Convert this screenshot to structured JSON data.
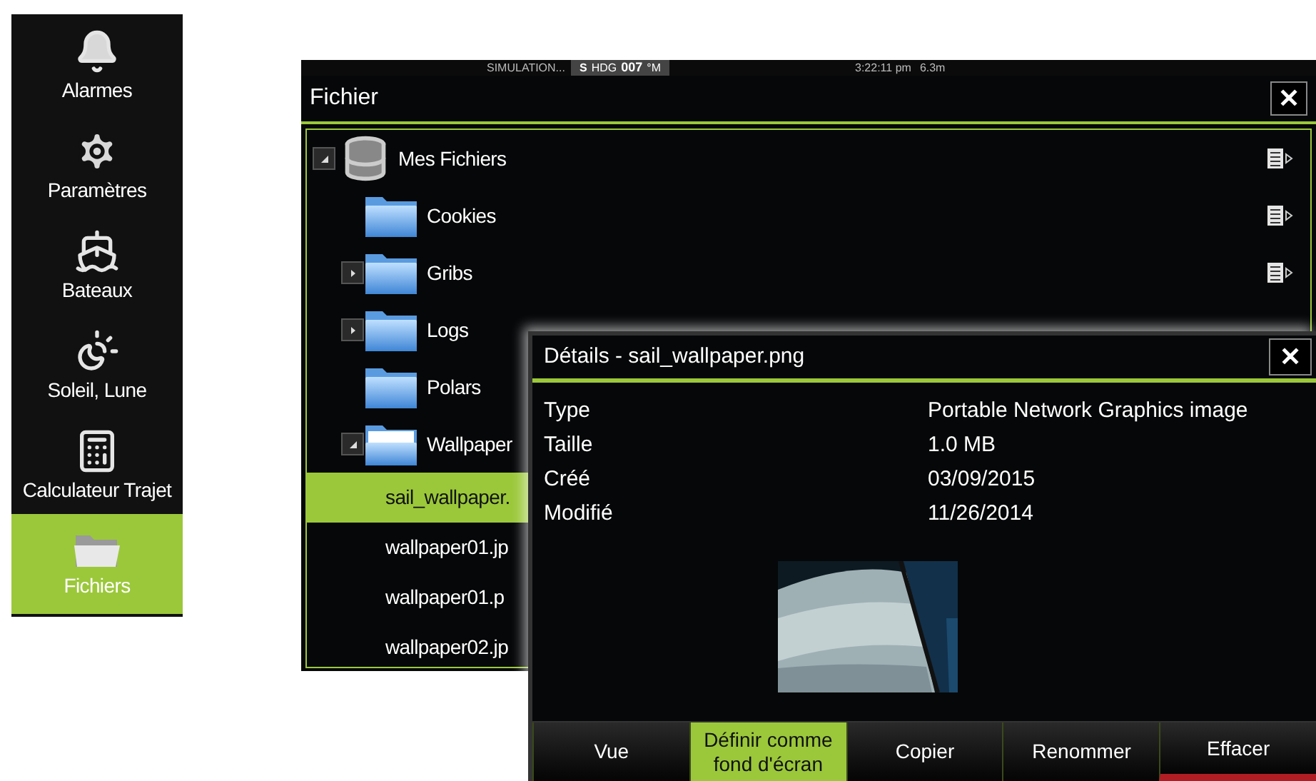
{
  "sidebar": {
    "items": [
      {
        "kind": "alarm",
        "label": "Alarmes",
        "selected": false
      },
      {
        "kind": "settings",
        "label": "Paramètres",
        "selected": false
      },
      {
        "kind": "boats",
        "label": "Bateaux",
        "selected": false
      },
      {
        "kind": "sun-moon",
        "label": "Soleil, Lune",
        "selected": false
      },
      {
        "kind": "calculator",
        "label": "Calculateur Trajet",
        "selected": false
      },
      {
        "kind": "files",
        "label": "Fichiers",
        "selected": true
      }
    ]
  },
  "status_bar": {
    "mode": "SIMULATION...",
    "heading_source": "S",
    "heading_label": "HDG",
    "heading_value": "007",
    "heading_unit": "°M",
    "time": "3:22:11 pm",
    "depth": "6.3m"
  },
  "file_window": {
    "title": "Fichier",
    "close": "✕",
    "tree": [
      {
        "kind": "drive",
        "label": "Mes Fichiers",
        "expanded": true,
        "selected": false,
        "menu": true,
        "children": [
          {
            "kind": "folder",
            "label": "Cookies",
            "selected": false,
            "menu": true
          },
          {
            "kind": "folder",
            "label": "Gribs",
            "expanded": false,
            "selected": false,
            "menu": true
          },
          {
            "kind": "folder",
            "label": "Logs",
            "expanded": false,
            "selected": false
          },
          {
            "kind": "folder",
            "label": "Polars",
            "selected": false
          },
          {
            "kind": "folder-open",
            "label": "Wallpaper",
            "expanded": true,
            "selected": false,
            "children": [
              {
                "kind": "file",
                "label": "sail_wallpaper.",
                "selected": true
              },
              {
                "kind": "file",
                "label": "wallpaper01.jp",
                "selected": false
              },
              {
                "kind": "file",
                "label": "wallpaper01.p",
                "selected": false
              },
              {
                "kind": "file",
                "label": "wallpaper02.jp",
                "selected": false
              }
            ]
          }
        ]
      }
    ]
  },
  "details_dialog": {
    "title": "Détails - sail_wallpaper.png",
    "close": "✕",
    "properties": [
      {
        "label": "Type",
        "value": "Portable Network Graphics image"
      },
      {
        "label": "Taille",
        "value": "1.0 MB"
      },
      {
        "label": "Créé",
        "value": "03/09/2015"
      },
      {
        "label": "Modifié",
        "value": "11/26/2014"
      }
    ],
    "buttons": [
      {
        "label": "Vue",
        "selected": false,
        "kind": "normal"
      },
      {
        "label": "Définir comme fond d'écran",
        "selected": true,
        "kind": "normal"
      },
      {
        "label": "Copier",
        "selected": false,
        "kind": "normal"
      },
      {
        "label": "Renommer",
        "selected": false,
        "kind": "normal"
      },
      {
        "label": "Effacer",
        "selected": false,
        "kind": "danger"
      }
    ]
  }
}
